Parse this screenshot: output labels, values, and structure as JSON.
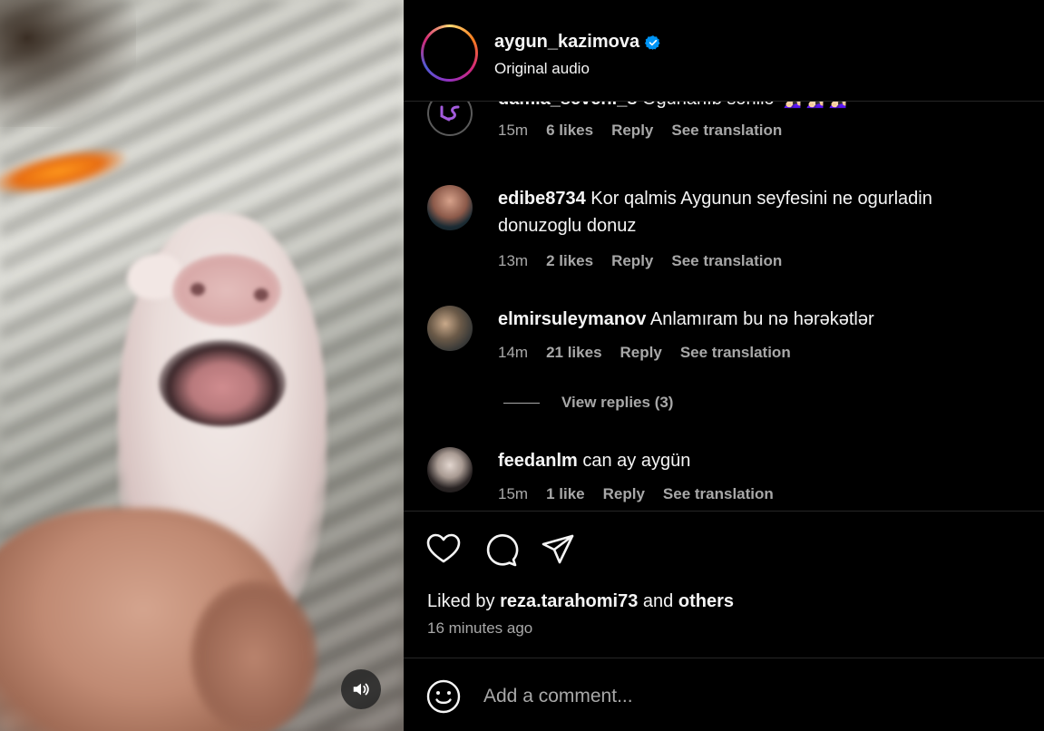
{
  "post": {
    "username": "aygun_kazimova",
    "audio": "Original audio",
    "verified": true
  },
  "comments": [
    {
      "username": "damla_seveni_s",
      "text": "Oğurlanıb sənilə 🧏🏻‍♀️🧏🏻‍♀️🧏🏻‍♀️",
      "time": "15m",
      "likes": "6 likes",
      "reply": "Reply",
      "translate": "See translation",
      "avatar_color": "#a35bdc"
    },
    {
      "username": "edibe8734",
      "text": "Kor qalmis Aygunun seyfesini ne ogurladin donuzoglu donuz",
      "time": "13m",
      "likes": "2 likes",
      "reply": "Reply",
      "translate": "See translation"
    },
    {
      "username": "elmirsuleymanov",
      "text": "Anlamıram bu nə hərəkətlər",
      "time": "14m",
      "likes": "21 likes",
      "reply": "Reply",
      "translate": "See translation",
      "view_replies": "View replies (3)"
    },
    {
      "username": "feedanlm",
      "text": "can ay aygün",
      "time": "15m",
      "likes": "1 like",
      "reply": "Reply",
      "translate": "See translation"
    }
  ],
  "actions": {
    "icons": [
      "heart-icon",
      "comment-icon",
      "share-icon"
    ],
    "liked_by_prefix": "Liked by",
    "liked_by_user": "reza.tarahomi73",
    "liked_by_and": "and",
    "liked_by_others": "others",
    "time_ago": "16 minutes ago"
  },
  "add_comment": {
    "placeholder": "Add a comment..."
  },
  "colors": {
    "background": "#000000",
    "text": "#f5f5f5",
    "secondary_text": "#a8a8a8",
    "verified": "#0095f6",
    "divider": "#262626"
  }
}
